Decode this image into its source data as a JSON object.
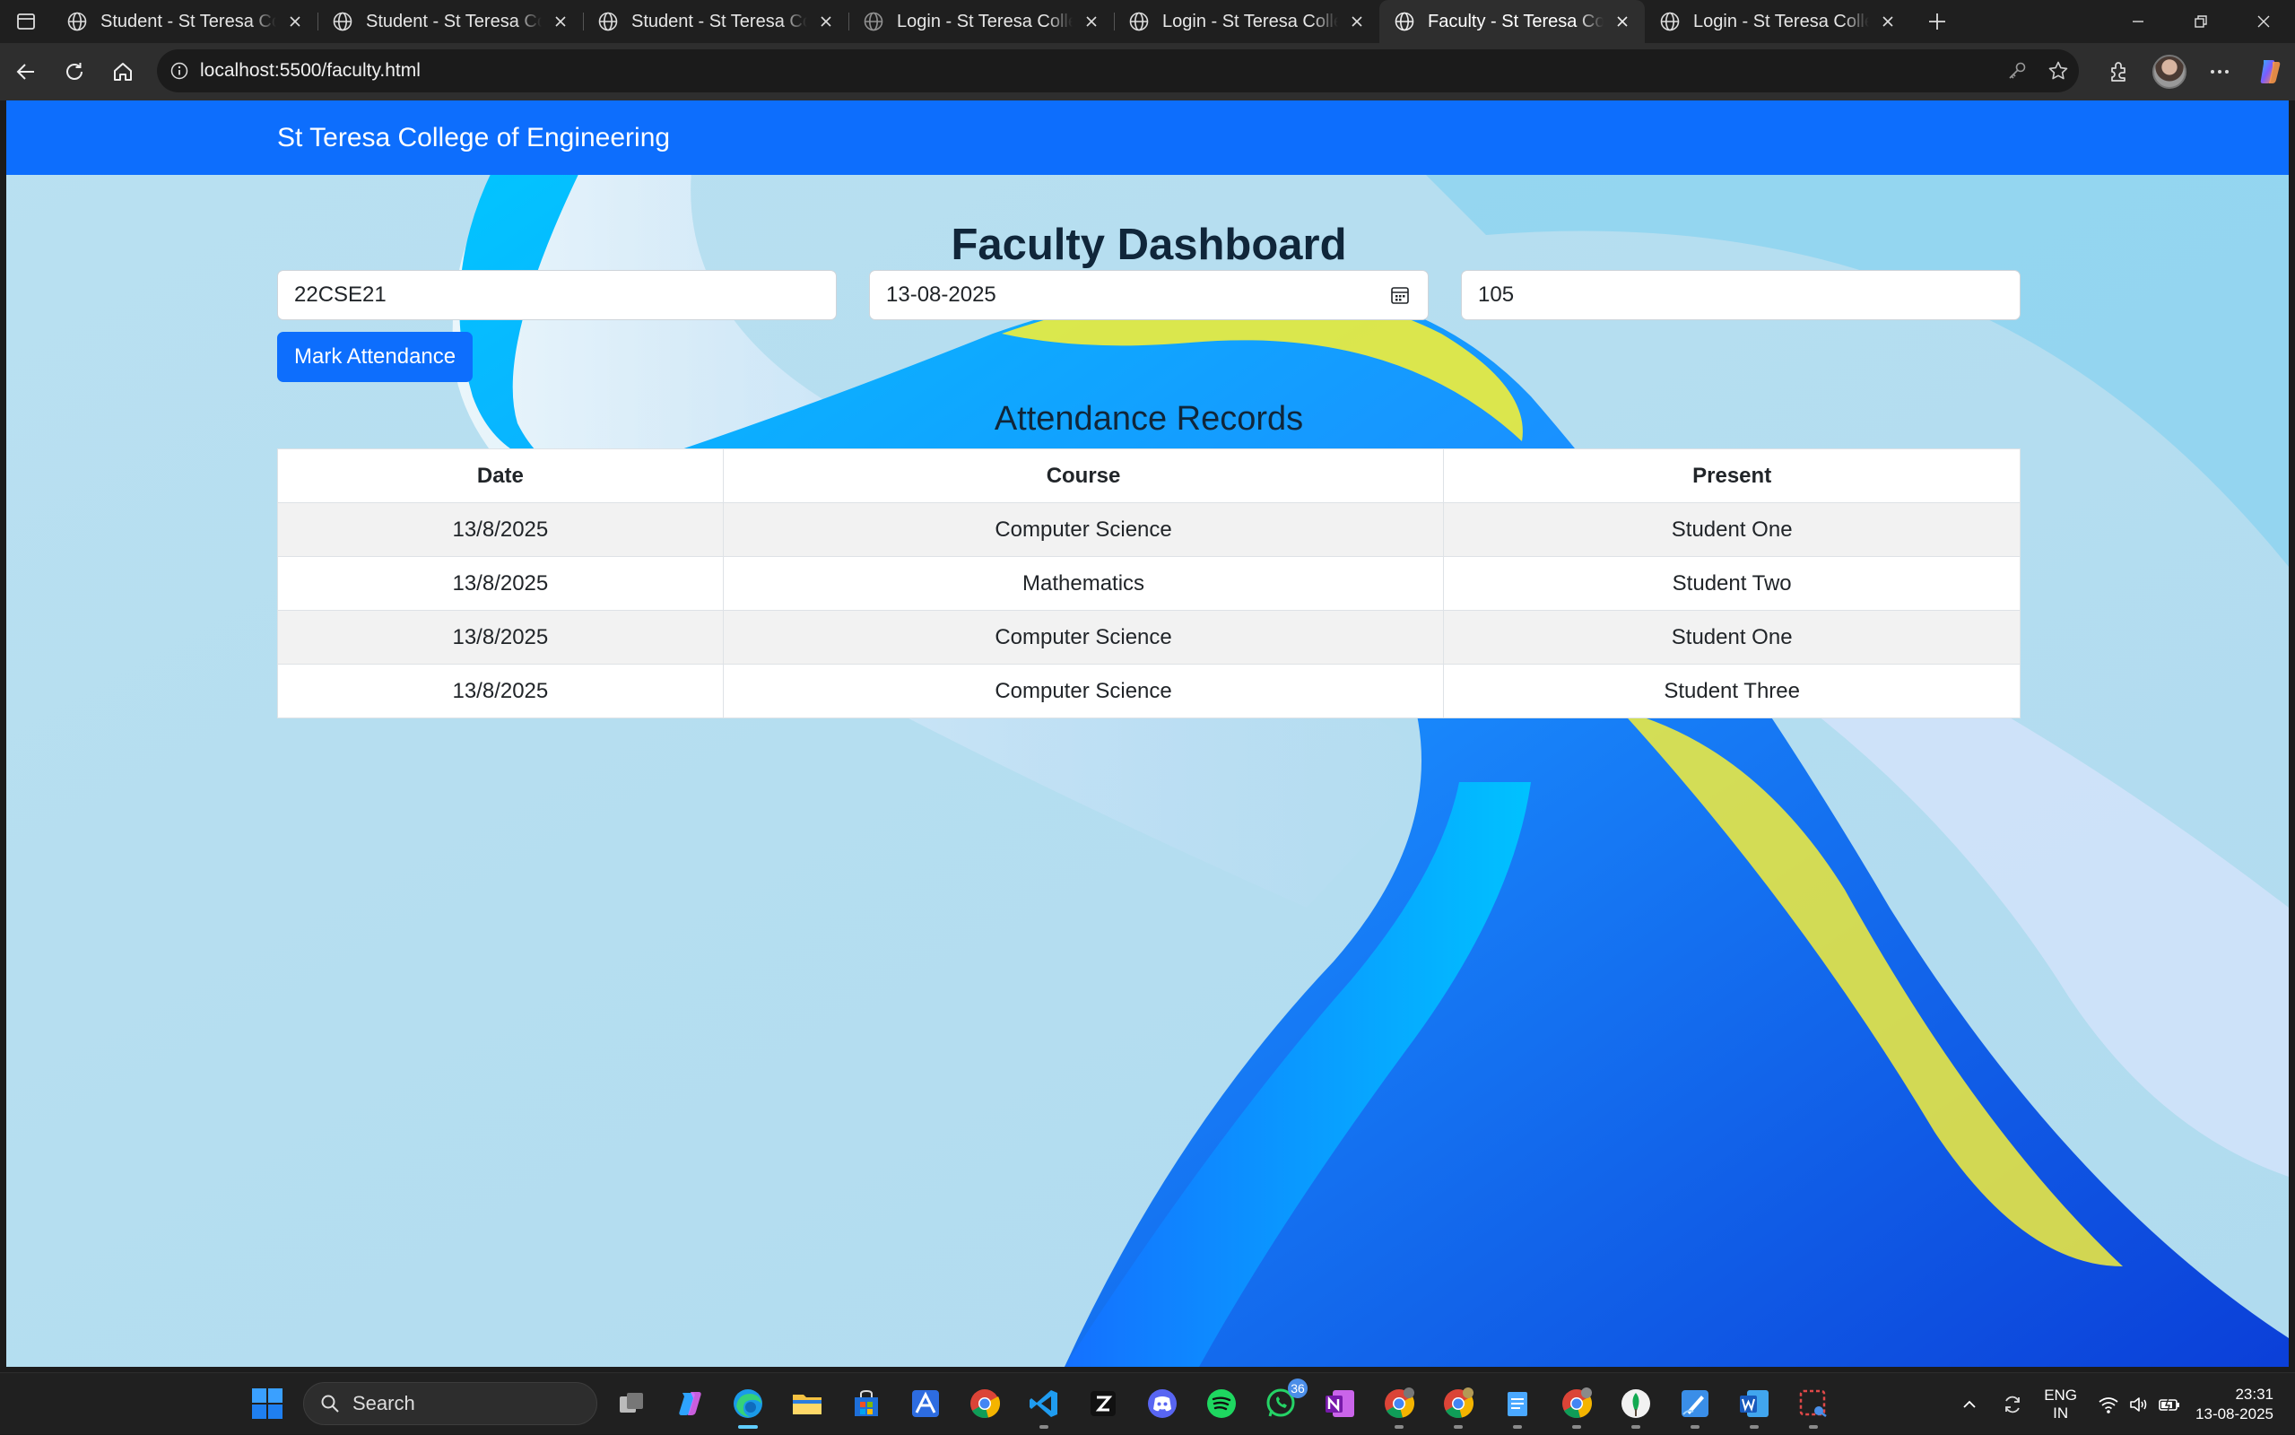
{
  "browser": {
    "tabs": [
      {
        "title": "Student - St Teresa College of Engineering",
        "active": false
      },
      {
        "title": "Student - St Teresa College of Engineering",
        "active": false
      },
      {
        "title": "Student - St Teresa College of Engineering",
        "active": false
      },
      {
        "title": "Login - St Teresa College of Engineering",
        "active": false
      },
      {
        "title": "Login - St Teresa College of Engineering",
        "active": false
      },
      {
        "title": "Faculty - St Teresa College of Engineering",
        "active": true
      },
      {
        "title": "Login - St Teresa College of Engineering",
        "active": false
      }
    ],
    "url": "localhost:5500/faculty.html"
  },
  "navbar": {
    "brand": "St Teresa College of Engineering"
  },
  "dashboard": {
    "title": "Faculty Dashboard",
    "course_code_value": "22CSE21",
    "date_value": "13-08-2025",
    "student_id_value": "105",
    "mark_button": "Mark Attendance",
    "records_title": "Attendance Records",
    "columns": [
      "Date",
      "Course",
      "Present"
    ],
    "rows": [
      [
        "13/8/2025",
        "Computer Science",
        "Student One"
      ],
      [
        "13/8/2025",
        "Mathematics",
        "Student Two"
      ],
      [
        "13/8/2025",
        "Computer Science",
        "Student One"
      ],
      [
        "13/8/2025",
        "Computer Science",
        "Student Three"
      ]
    ]
  },
  "taskbar": {
    "search_label": "Search",
    "whatsapp_badge": "36",
    "lang_line1": "ENG",
    "lang_line2": "IN",
    "time": "23:31",
    "date": "13-08-2025"
  },
  "colors": {
    "navbar": "#0d6efd",
    "button": "#0d6efd",
    "page_background": "#b7dff0",
    "taskbar_active_indicator": "#60cdff"
  }
}
